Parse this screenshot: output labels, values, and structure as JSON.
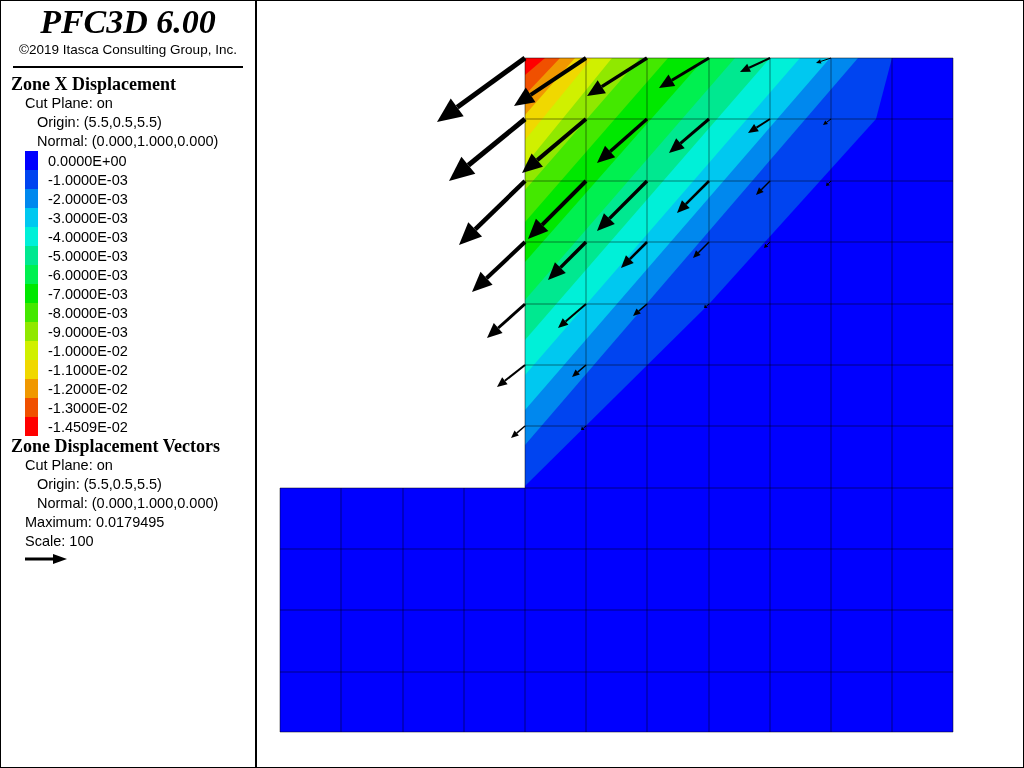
{
  "header": {
    "title": "PFC3D 6.00",
    "copyright": "©2019 Itasca Consulting Group, Inc."
  },
  "legend": [
    {
      "kind": "contour",
      "title": "Zone X Displacement",
      "cut_plane": {
        "label": "Cut Plane: on",
        "children": [
          "Origin: (5.5,0.5,5.5)",
          "Normal: (0.000,1.000,0.000)"
        ]
      },
      "bands": [
        {
          "label": "0.0000E+00",
          "color": "#0000ff"
        },
        {
          "label": "-1.0000E-03",
          "color": "#0044f0"
        },
        {
          "label": "-2.0000E-03",
          "color": "#0088ee"
        },
        {
          "label": "-3.0000E-03",
          "color": "#00c8f0"
        },
        {
          "label": "-4.0000E-03",
          "color": "#00f0d8"
        },
        {
          "label": "-5.0000E-03",
          "color": "#00e890"
        },
        {
          "label": "-6.0000E-03",
          "color": "#00f050"
        },
        {
          "label": "-7.0000E-03",
          "color": "#00e800"
        },
        {
          "label": "-8.0000E-03",
          "color": "#44e800"
        },
        {
          "label": "-9.0000E-03",
          "color": "#90e800"
        },
        {
          "label": "-1.0000E-02",
          "color": "#d0f000"
        },
        {
          "label": "-1.1000E-02",
          "color": "#f0d800"
        },
        {
          "label": "-1.2000E-02",
          "color": "#f09800"
        },
        {
          "label": "-1.3000E-02",
          "color": "#f05000"
        },
        {
          "label": "-1.4509E-02",
          "color": "#ff0000"
        }
      ]
    },
    {
      "kind": "vectors",
      "title": "Zone Displacement Vectors",
      "cut_plane": {
        "label": "Cut Plane: on",
        "children": [
          "Origin: (5.5,0.5,5.5)",
          "Normal: (0.000,1.000,0.000)"
        ]
      },
      "maximum": "Maximum: 0.0179495",
      "scale": "Scale: 100"
    }
  ]
}
